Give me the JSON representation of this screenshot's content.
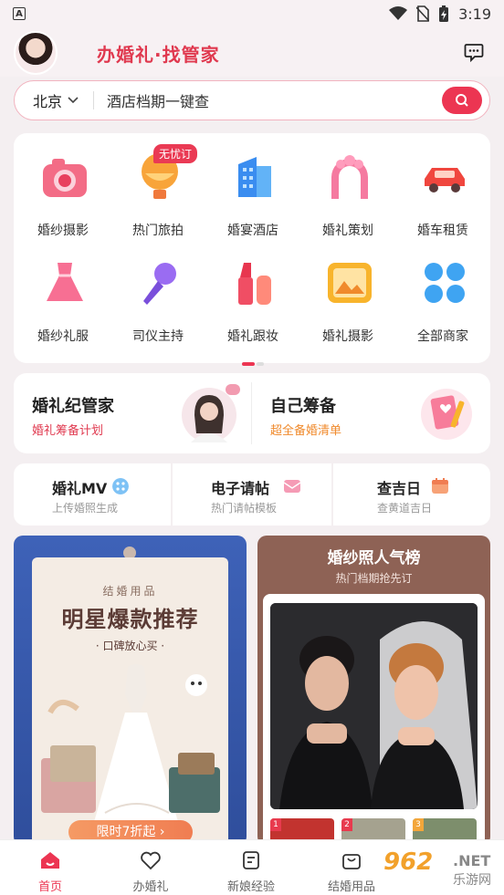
{
  "status_bar": {
    "time": "3:19",
    "indicator": "A"
  },
  "header": {
    "slogan": "办婚礼·找管家"
  },
  "search": {
    "city": "北京",
    "placeholder": "酒店档期一键查"
  },
  "categories": [
    {
      "label": "婚纱摄影",
      "icon": "camera-icon"
    },
    {
      "label": "热门旅拍",
      "icon": "hot-air-balloon-icon",
      "badge": "无忧订"
    },
    {
      "label": "婚宴酒店",
      "icon": "hotel-building-icon"
    },
    {
      "label": "婚礼策划",
      "icon": "floral-arch-icon"
    },
    {
      "label": "婚车租赁",
      "icon": "car-icon"
    },
    {
      "label": "婚纱礼服",
      "icon": "dress-icon"
    },
    {
      "label": "司仪主持",
      "icon": "microphone-icon"
    },
    {
      "label": "婚礼跟妆",
      "icon": "lipstick-icon"
    },
    {
      "label": "婚礼摄影",
      "icon": "picture-icon"
    },
    {
      "label": "全部商家",
      "icon": "grid-icon"
    }
  ],
  "planning": {
    "manager": {
      "title": "婚礼纪管家",
      "subtitle": "婚礼筹备计划"
    },
    "self": {
      "title": "自己筹备",
      "subtitle": "超全备婚清单"
    }
  },
  "tools": [
    {
      "title": "婚礼MV",
      "subtitle": "上传婚照生成"
    },
    {
      "title": "电子请帖",
      "subtitle": "热门请帖模板"
    },
    {
      "title": "查吉日",
      "subtitle": "查黄道吉日"
    }
  ],
  "promo_left": {
    "small": "结婚用品",
    "big": "明星爆款推荐",
    "tag": "· 口碑放心买 ·",
    "cta": "限时7折起 ›"
  },
  "promo_right": {
    "title": "婚纱照人气榜",
    "subtitle": "热门档期抢先订",
    "ranks": [
      "1",
      "2",
      "3"
    ]
  },
  "tabbar": [
    {
      "label": "首页",
      "active": true
    },
    {
      "label": "办婚礼"
    },
    {
      "label": "新娘经验"
    },
    {
      "label": "结婚用品"
    }
  ],
  "watermark": {
    "num": "962",
    "net": ".NET",
    "cn": "乐游网"
  },
  "colors": {
    "accent": "#ec3552",
    "brand_text": "#e0394f",
    "orange": "#f08a2c"
  }
}
